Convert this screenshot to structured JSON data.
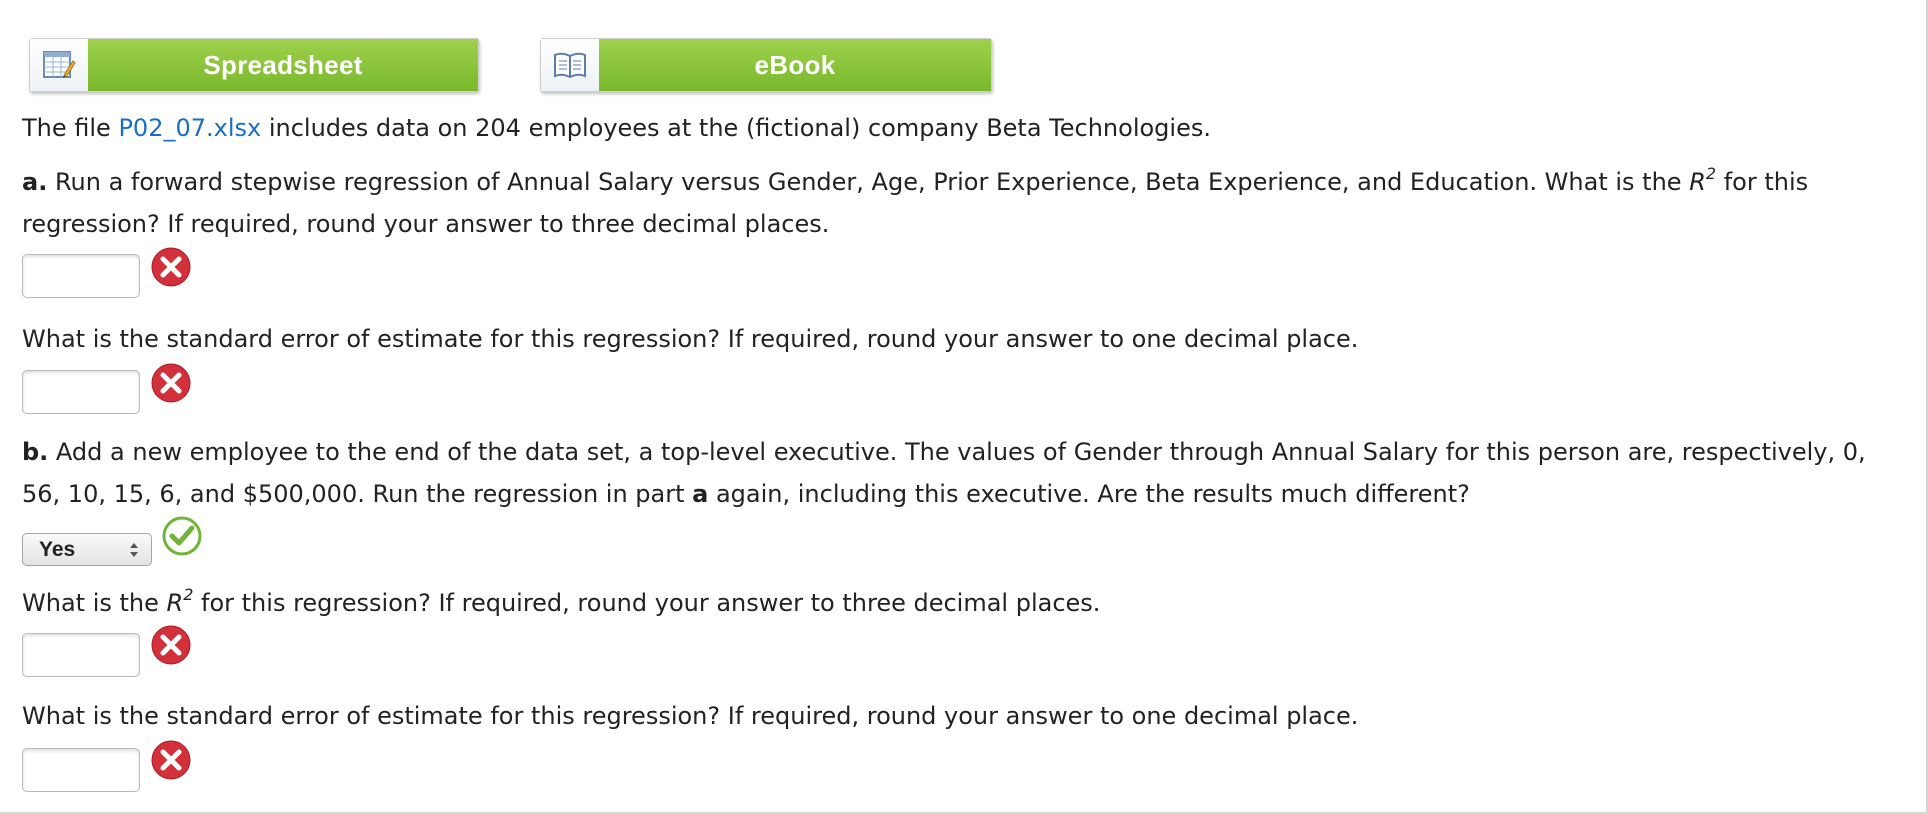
{
  "toolbar": {
    "spreadsheet_label": "Spreadsheet",
    "ebook_label": "eBook"
  },
  "intro": {
    "before": "The file ",
    "file_link": "P02_07.xlsx",
    "after": " includes data on 204 employees at the (fictional) company Beta Technologies."
  },
  "part_a": {
    "letter": "a.",
    "question_before": " Run a forward stepwise regression of Annual Salary versus Gender, Age, Prior Experience, Beta Experience, and Education. What is the ",
    "r": "R",
    "sup": "2",
    "question_after": " for this regression? If required, round your answer to three decimal places.",
    "r2_value": "",
    "r2_status": "incorrect",
    "se_question": "What is the standard error of estimate for this regression? If required, round your answer to one decimal place.",
    "se_value": "",
    "se_status": "incorrect"
  },
  "part_b": {
    "letter": "b.",
    "question_before": " Add a new employee to the end of the data set, a top-level executive. The values of Gender through Annual Salary for this person are, respectively, 0, 56, 10, 15, 6, and $500,000. Run the regression in part ",
    "part_ref": "a",
    "question_after": " again, including this executive. Are the results much different?",
    "different_selected": "Yes",
    "different_status": "correct",
    "r2_question_before": "What is the ",
    "r": "R",
    "sup": "2",
    "r2_question_after": " for this regression? If required, round your answer to three decimal places.",
    "r2_value": "",
    "r2_status": "incorrect",
    "se_question": "What is the standard error of estimate for this regression? If required, round your answer to one decimal place.",
    "se_value": "",
    "se_status": "incorrect"
  },
  "colors": {
    "button_green": "#8cc43e",
    "link_blue": "#1a6fc4",
    "incorrect_red": "#d2303a",
    "correct_green": "#6fb33a"
  }
}
